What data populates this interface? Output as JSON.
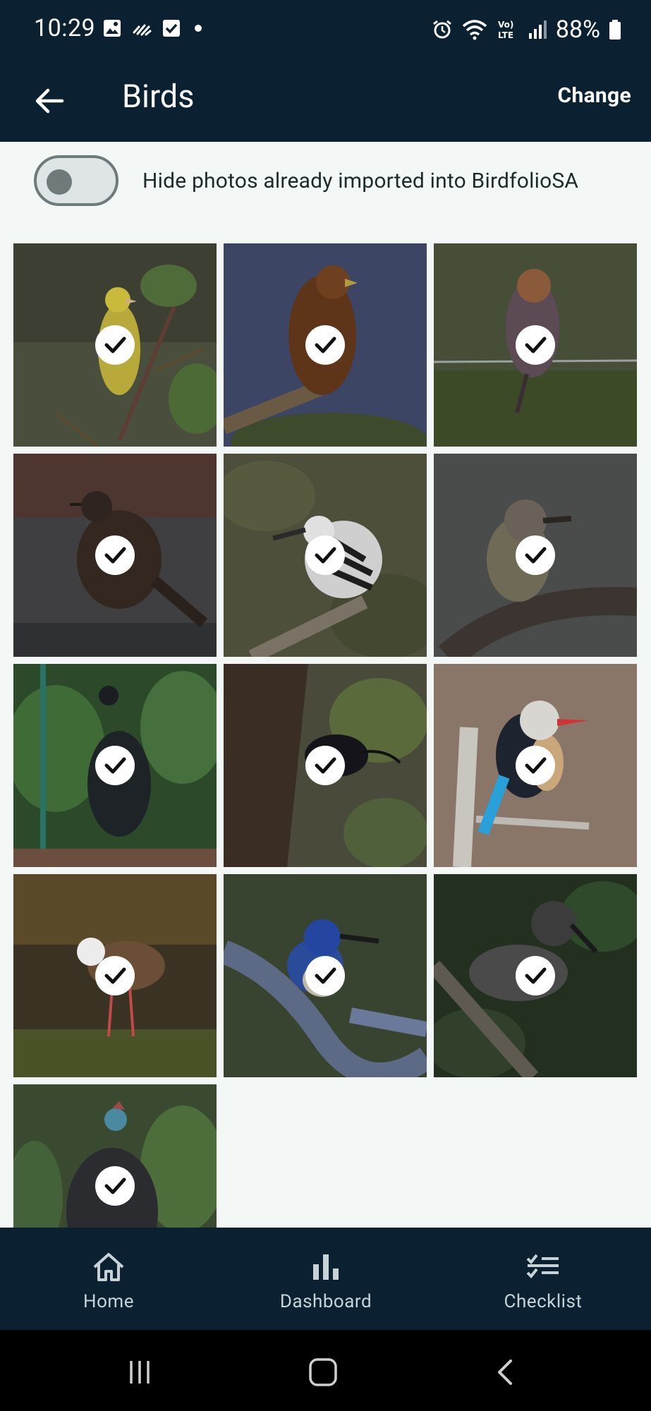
{
  "status": {
    "time": "10:29",
    "battery": "88%"
  },
  "appbar": {
    "title": "Birds",
    "change_label": "Change"
  },
  "filter": {
    "hide_imported_label": "Hide photos already imported into BirdfolioSA",
    "enabled": false
  },
  "photos": [
    {
      "selected": true
    },
    {
      "selected": true
    },
    {
      "selected": true
    },
    {
      "selected": true
    },
    {
      "selected": true
    },
    {
      "selected": true
    },
    {
      "selected": true
    },
    {
      "selected": true
    },
    {
      "selected": true
    },
    {
      "selected": true
    },
    {
      "selected": true
    },
    {
      "selected": true
    },
    {
      "selected": true
    }
  ],
  "nav": {
    "home": "Home",
    "dashboard": "Dashboard",
    "checklist": "Checklist"
  },
  "colors": {
    "bar": "#0b2131",
    "background": "#f3f8f6"
  }
}
